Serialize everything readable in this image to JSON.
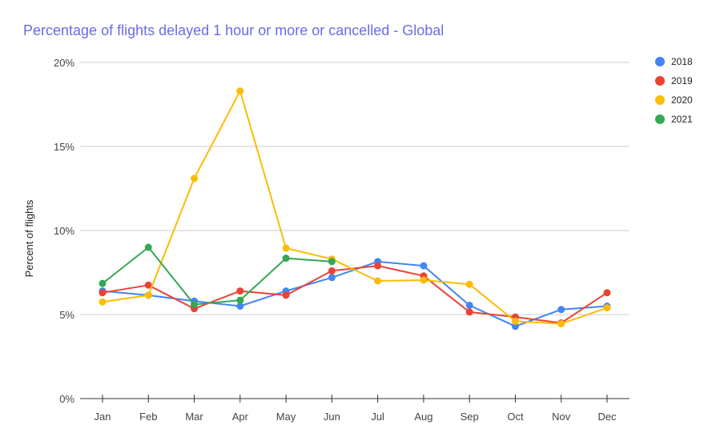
{
  "chart_data": {
    "type": "line",
    "title": "Percentage of flights delayed 1 hour or more or cancelled - Global",
    "xlabel": "",
    "ylabel": "Percent of flights",
    "categories": [
      "Jan",
      "Feb",
      "Mar",
      "Apr",
      "May",
      "Jun",
      "Jul",
      "Aug",
      "Sep",
      "Oct",
      "Nov",
      "Dec"
    ],
    "ylim": [
      0,
      20
    ],
    "yticks": [
      0,
      5,
      10,
      15,
      20
    ],
    "ytick_labels": [
      "0%",
      "5%",
      "10%",
      "15%",
      "20%"
    ],
    "grid": true,
    "legend_position": "right",
    "series": [
      {
        "name": "2018",
        "color": "#4285f4",
        "values": [
          6.4,
          6.15,
          5.8,
          5.5,
          6.4,
          7.2,
          8.15,
          7.9,
          5.55,
          4.3,
          5.3,
          5.5
        ]
      },
      {
        "name": "2019",
        "color": "#ea4335",
        "values": [
          6.3,
          6.75,
          5.35,
          6.4,
          6.15,
          7.6,
          7.9,
          7.3,
          5.15,
          4.85,
          4.5,
          6.3
        ]
      },
      {
        "name": "2020",
        "color": "#fbbc04",
        "values": [
          5.75,
          6.15,
          13.1,
          18.3,
          8.95,
          8.3,
          7.0,
          7.05,
          6.8,
          4.6,
          4.45,
          5.4
        ]
      },
      {
        "name": "2021",
        "color": "#34a853",
        "values": [
          6.85,
          9.0,
          5.6,
          5.85,
          8.35,
          8.15
        ]
      }
    ]
  }
}
